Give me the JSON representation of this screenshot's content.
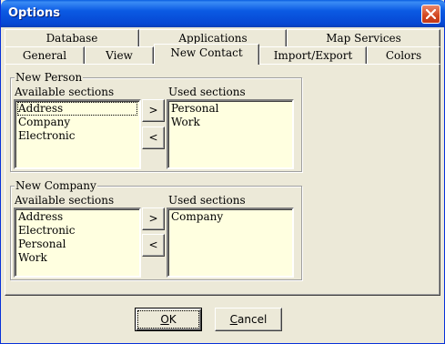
{
  "window": {
    "title": "Options"
  },
  "tabs": {
    "row_back": [
      "Database",
      "Applications",
      "Map Services"
    ],
    "row_front": [
      "General",
      "View",
      "New Contact",
      "Import/Export",
      "Colors"
    ],
    "active": "New Contact"
  },
  "new_person": {
    "group_label": "New Person",
    "available_label": "Available sections",
    "used_label": "Used sections",
    "available": [
      "Address",
      "Company",
      "Electronic"
    ],
    "used": [
      "Personal",
      "Work"
    ],
    "add_label": ">",
    "remove_label": "<"
  },
  "new_company": {
    "group_label": "New Company",
    "available_label": "Available sections",
    "used_label": "Used sections",
    "available": [
      "Address",
      "Electronic",
      "Personal",
      "Work"
    ],
    "used": [
      "Company"
    ],
    "add_label": ">",
    "remove_label": "<"
  },
  "footer": {
    "ok_label": "OK",
    "cancel_label": "Cancel"
  },
  "colors": {
    "titlebar": "#0a5ee0",
    "listbox_bg": "#ffffe0",
    "face": "#ece9d8"
  }
}
